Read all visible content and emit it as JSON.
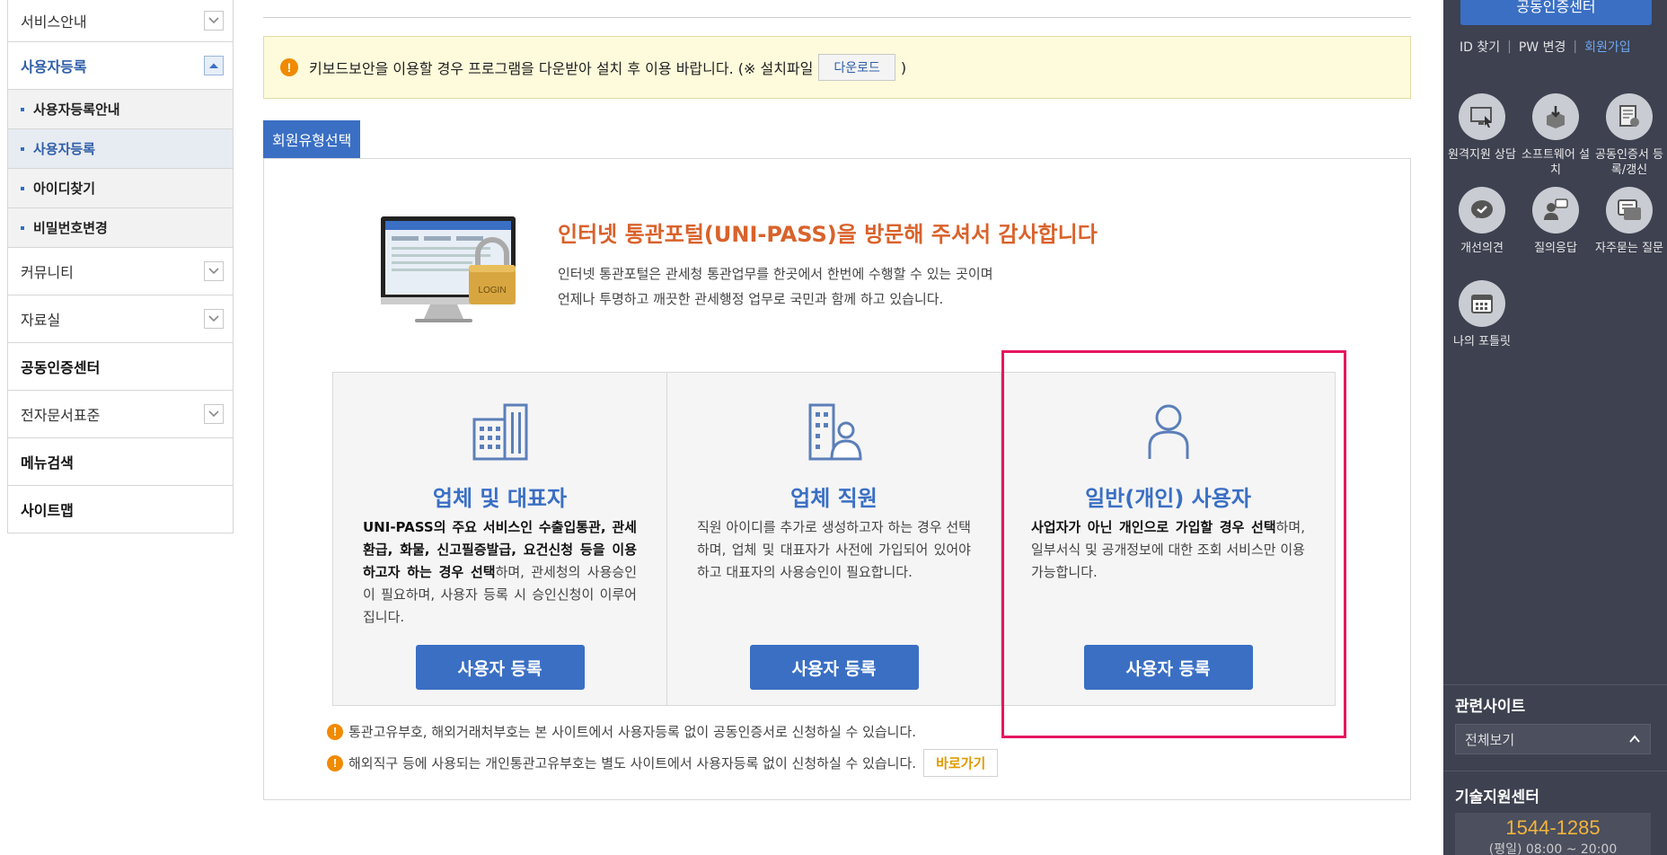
{
  "sidebar": {
    "items": [
      {
        "label": "서비스안내"
      },
      {
        "label": "사용자등록"
      },
      {
        "label": "커뮤니티"
      },
      {
        "label": "자료실"
      },
      {
        "label": "공동인증센터"
      },
      {
        "label": "전자문서표준"
      },
      {
        "label": "메뉴검색"
      },
      {
        "label": "사이트맵"
      }
    ],
    "subitems": [
      {
        "label": "사용자등록안내"
      },
      {
        "label": "사용자등록"
      },
      {
        "label": "아이디찾기"
      },
      {
        "label": "비밀번호변경"
      }
    ]
  },
  "notice": {
    "text": "키보드보안을 이용할 경우 프로그램을 다운받아 설치 후 이용 바랍니다. (※ 설치파일",
    "download_label": "다운로드",
    "close_paren": ")"
  },
  "tab": {
    "label": "회원유형선택"
  },
  "intro": {
    "image_text": "LOGIN",
    "title": "인터넷 통관포털(UNI-PASS)을 방문해 주셔서 감사합니다",
    "line1": "인터넷 통관포털은 관세청 통관업무를 한곳에서 한번에 수행할 수 있는 곳이며",
    "line2": "언제나 투명하고 깨끗한 관세행정 업무로 국민과 함께 하고 있습니다."
  },
  "cards": [
    {
      "title": "업체 및 대표자",
      "desc_bold": "UNI-PASS의 주요 서비스인 수출입통관, 관세환급, 화물, 신고필증발급, 요건신청 등을 이용하고자 하는 경우 선택",
      "desc_rest": "하며, 관세청의 사용승인이 필요하며, 사용자 등록 시 승인신청이 이루어집니다.",
      "button": "사용자 등록",
      "icon": "building-icon"
    },
    {
      "title": "업체 직원",
      "desc_bold": "",
      "desc_rest": "직원 아이디를 추가로 생성하고자 하는 경우 선택하며, 업체 및 대표자가 사전에 가입되어 있어야 하고 대표자의 사용승인이 필요합니다.",
      "button": "사용자 등록",
      "icon": "building-person-icon"
    },
    {
      "title": "일반(개인) 사용자",
      "desc_bold": "사업자가 아닌 개인으로 가입할 경우 선택",
      "desc_rest": "하며, 일부서식 및 공개정보에 대한 조회 서비스만 이용 가능합니다.",
      "button": "사용자 등록",
      "icon": "person-icon"
    }
  ],
  "notes": [
    {
      "text": "통관고유부호, 해외거래처부호는 본 사이트에서 사용자등록 없이 공동인증서로 신청하실 수 있습니다."
    },
    {
      "text": "해외직구 등에 사용되는 개인통관고유부호는 별도 사이트에서 사용자등록 없이 신청하실 수 있습니다.",
      "button": "바로가기"
    }
  ],
  "right": {
    "cert_button": "공동인증센터",
    "links": {
      "id": "ID 찾기",
      "pw": "PW 변경",
      "join": "회원가입"
    },
    "quick": [
      {
        "label": "원격지원 상담",
        "icon": "monitor-icon"
      },
      {
        "label": "소프트웨어 설치",
        "icon": "download-box-icon"
      },
      {
        "label": "공동인증서 등록/갱신",
        "icon": "certificate-icon"
      },
      {
        "label": "개선의견",
        "icon": "speech-check-icon"
      },
      {
        "label": "질의응답",
        "icon": "qna-icon"
      },
      {
        "label": "자주묻는 질문",
        "icon": "faq-icon"
      },
      {
        "label": "나의 포틀릿",
        "icon": "calendar-icon"
      }
    ],
    "related_title": "관련사이트",
    "related_select": "전체보기",
    "tech_title": "기술지원센터",
    "tech_phone": "1544-1285",
    "tech_hours": "(평일) 08:00 ~ 20:00"
  },
  "colors": {
    "accent": "#3a6fc4",
    "highlight": "#e5175f",
    "intro_title": "#d9622b",
    "dark_panel": "#3d4150"
  }
}
